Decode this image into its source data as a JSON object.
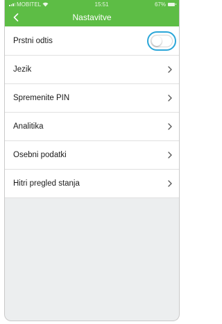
{
  "status_bar": {
    "carrier": "MOBITEL",
    "time": "15:51",
    "battery": "67%"
  },
  "nav": {
    "back_icon": "chevron-left-icon",
    "title": "Nastavitve"
  },
  "settings": {
    "fingerprint": {
      "label": "Prstni odtis",
      "enabled": false
    },
    "items": [
      {
        "label": "Jezik"
      },
      {
        "label": "Spremenite PIN"
      },
      {
        "label": "Analitika"
      },
      {
        "label": "Osebni podatki"
      },
      {
        "label": "Hitri pregled stanja"
      }
    ]
  },
  "colors": {
    "brand_green": "#5dbd45",
    "highlight_ring": "#2aa6d8",
    "background": "#eceeef"
  }
}
